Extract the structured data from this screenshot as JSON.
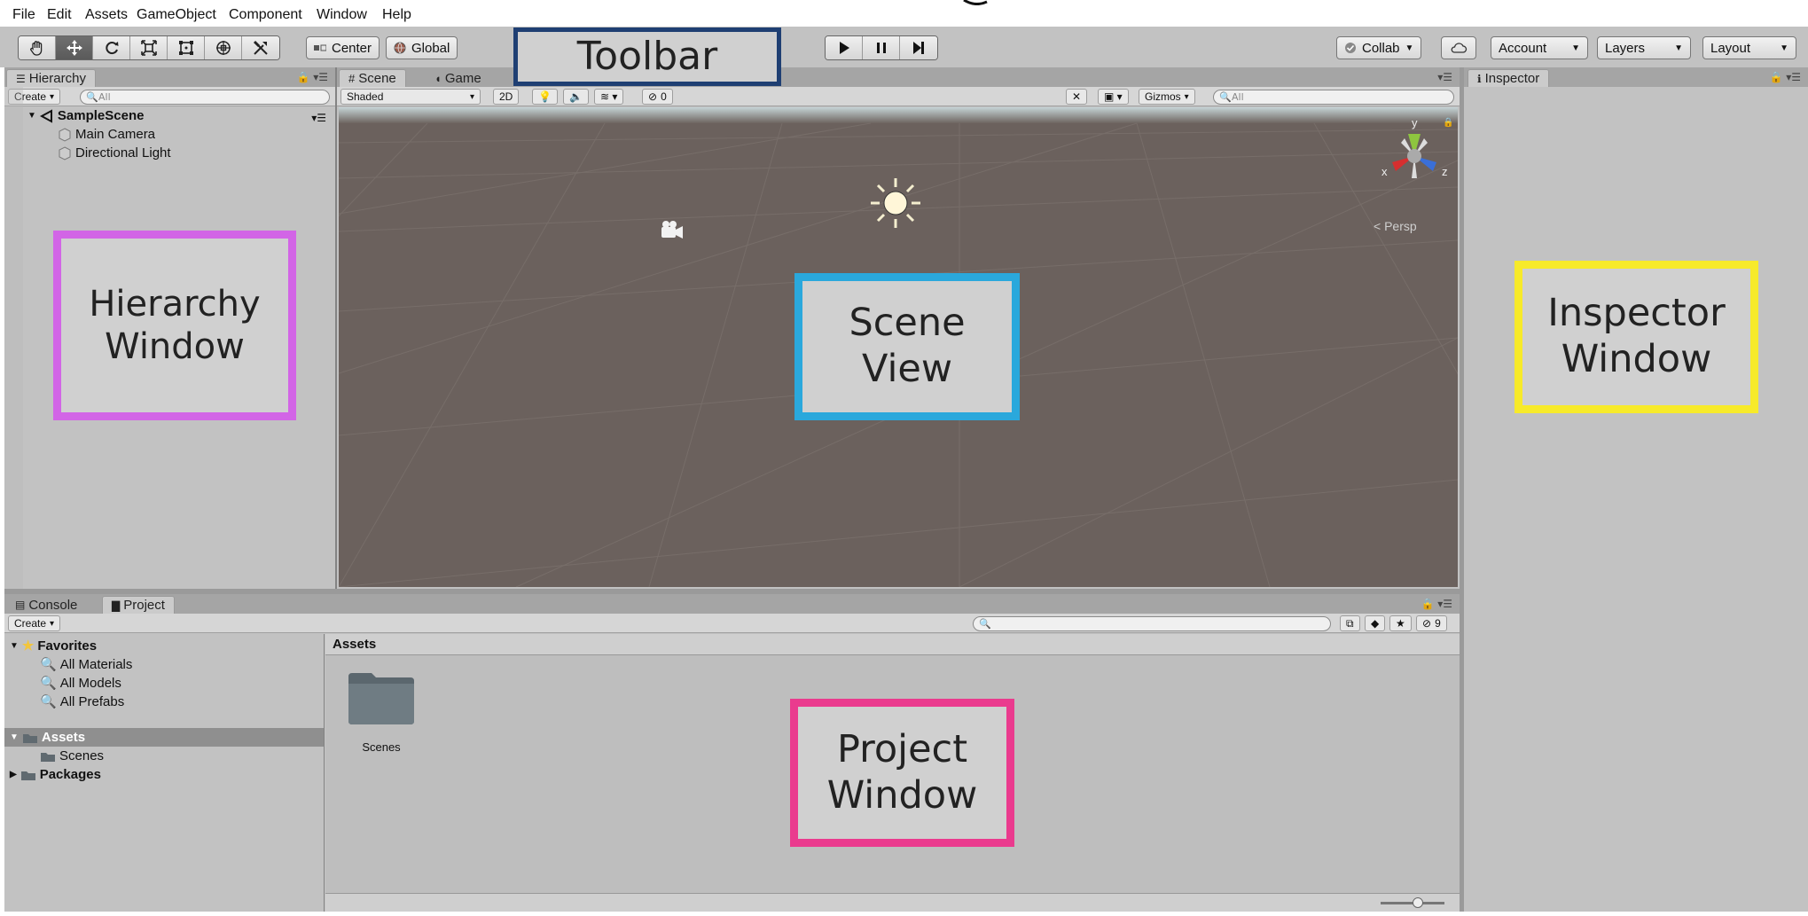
{
  "menubar": {
    "items": [
      "File",
      "Edit",
      "Assets",
      "GameObject",
      "Component",
      "Window",
      "Help"
    ]
  },
  "toolbar": {
    "pivot_label": "Center",
    "space_label": "Global",
    "collab_label": "Collab",
    "account_label": "Account",
    "layers_label": "Layers",
    "layout_label": "Layout"
  },
  "hierarchy": {
    "tab_label": "Hierarchy",
    "create_label": "Create",
    "search_placeholder": "All",
    "scene_name": "SampleScene",
    "items": [
      "Main Camera",
      "Directional Light"
    ]
  },
  "scene_view": {
    "tabs": [
      "Scene",
      "Game"
    ],
    "shading_mode": "Shaded",
    "mode_2d_label": "2D",
    "hidden_count": "0",
    "gizmos_label": "Gizmos",
    "search_placeholder": "All",
    "axis_labels": {
      "x": "x",
      "y": "y",
      "z": "z"
    },
    "projection_label": "Persp",
    "bg_color": "#6b615d"
  },
  "inspector": {
    "tab_label": "Inspector"
  },
  "bottom_panel": {
    "tabs": [
      "Console",
      "Project"
    ],
    "create_label": "Create",
    "favorites_label": "Favorites",
    "favorites_items": [
      "All Materials",
      "All Models",
      "All Prefabs"
    ],
    "assets_label": "Assets",
    "assets_children": [
      "Scenes"
    ],
    "packages_label": "Packages",
    "breadcrumb": "Assets",
    "grid_items": [
      "Scenes"
    ],
    "hidden_count": "9"
  },
  "callouts": {
    "toolbar": "Toolbar",
    "hierarchy_line1": "Hierarchy",
    "hierarchy_line2": "Window",
    "scene_line1": "Scene",
    "scene_line2": "View",
    "inspector_line1": "Inspector",
    "inspector_line2": "Window",
    "project_line1": "Project",
    "project_line2": "Window"
  },
  "colors": {
    "toolbar_callout_border": "#1f3f73",
    "hierarchy_callout_border": "#d265e6",
    "scene_callout_border": "#2aa8dc",
    "inspector_callout_border": "#f7ea2a",
    "project_callout_border": "#ea3b8e"
  }
}
